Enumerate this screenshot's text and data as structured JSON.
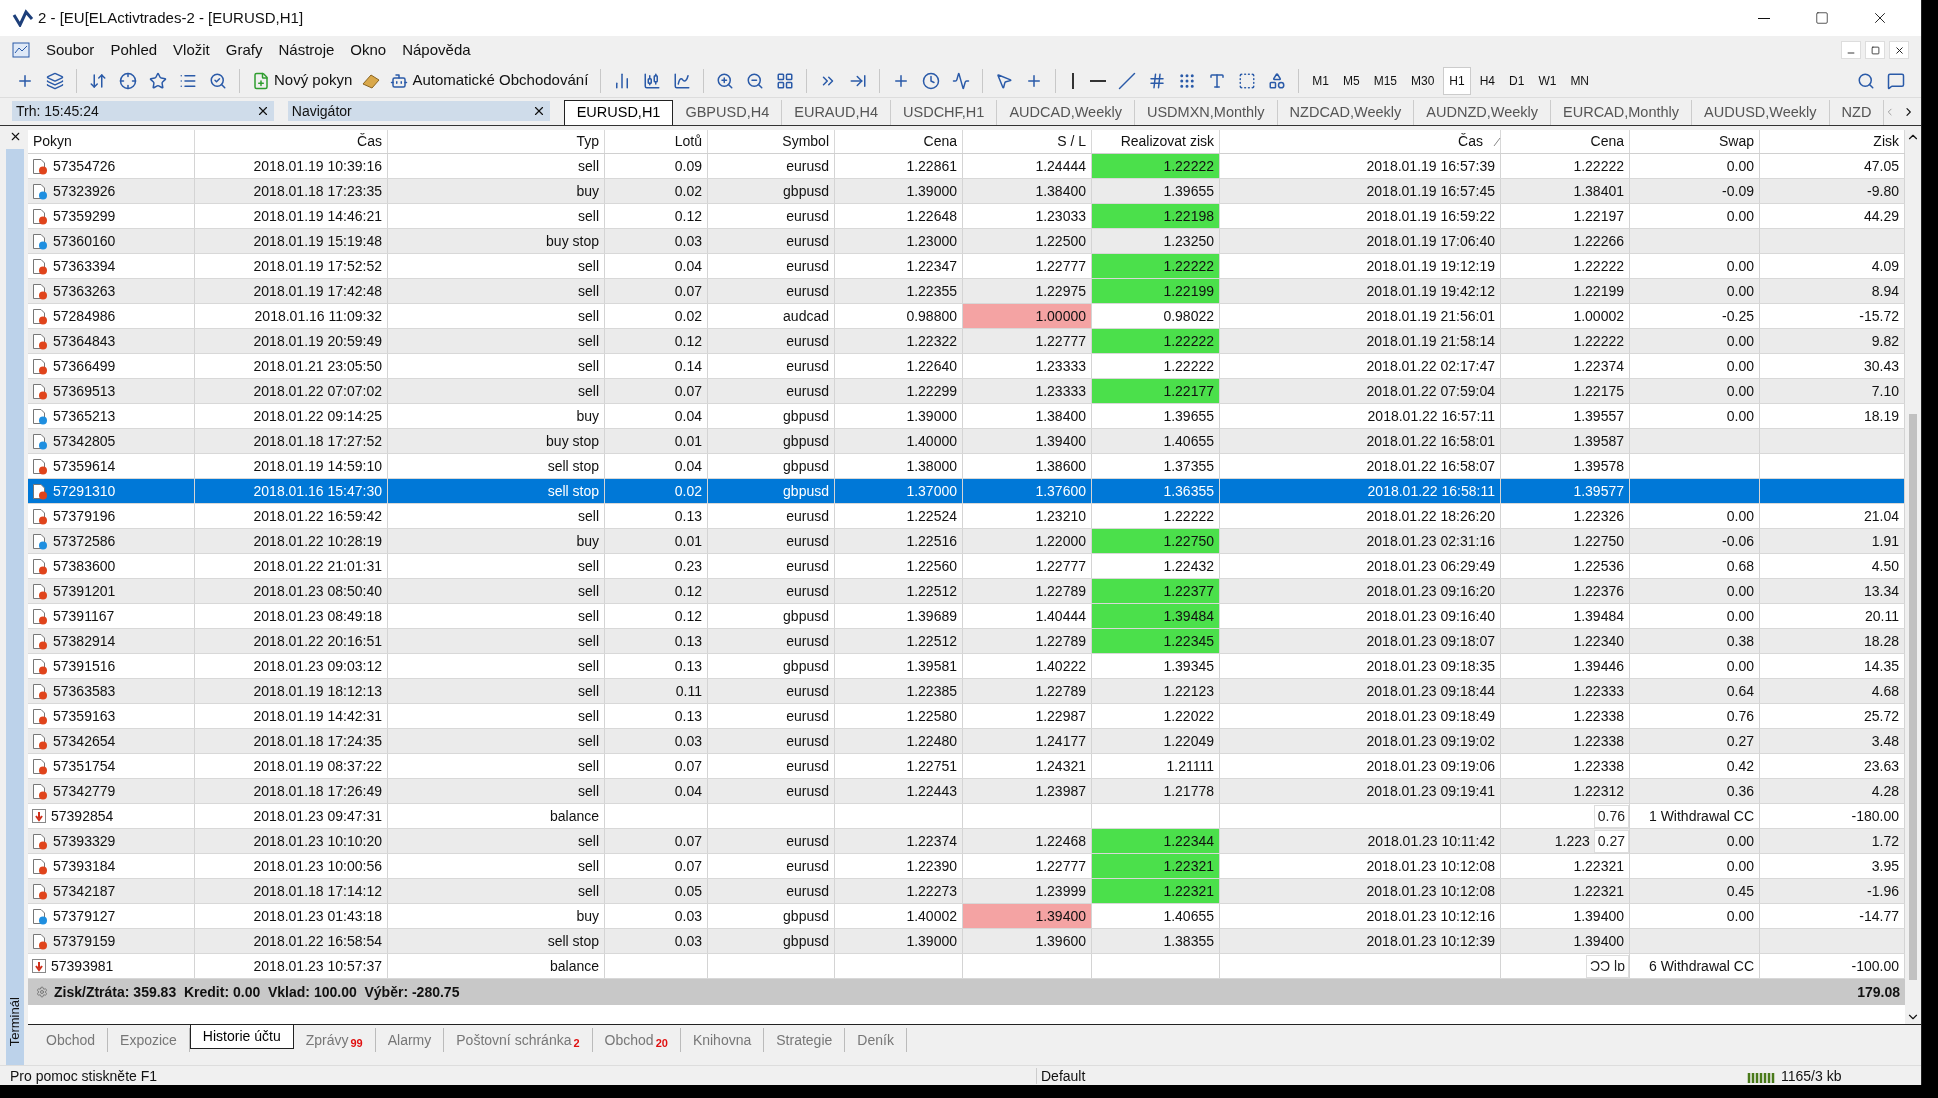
{
  "window": {
    "title": "2 - [EU[ELActivtrades-2 - [EURUSD,H1]"
  },
  "menu": [
    "Soubor",
    "Pohled",
    "Vložit",
    "Grafy",
    "Nástroje",
    "Okno",
    "Nápověda"
  ],
  "toolbar": {
    "new_order": "Nový pokyn",
    "auto_trading": "Automatické Obchodování"
  },
  "timeframes": [
    {
      "label": "M1",
      "selected": false
    },
    {
      "label": "M5",
      "selected": false
    },
    {
      "label": "M15",
      "selected": false
    },
    {
      "label": "M30",
      "selected": false
    },
    {
      "label": "H1",
      "selected": true
    },
    {
      "label": "H4",
      "selected": false
    },
    {
      "label": "D1",
      "selected": false
    },
    {
      "label": "W1",
      "selected": false
    },
    {
      "label": "MN",
      "selected": false
    }
  ],
  "panels": [
    {
      "title": "Trh: 15:45:24"
    },
    {
      "title": "Navigátor"
    }
  ],
  "chart_tabs": [
    {
      "label": "EURUSD,H1",
      "selected": true
    },
    {
      "label": "GBPUSD,H4",
      "selected": false
    },
    {
      "label": "EURAUD,H4",
      "selected": false
    },
    {
      "label": "USDCHF,H1",
      "selected": false
    },
    {
      "label": "AUDCAD,Weekly",
      "selected": false
    },
    {
      "label": "USDMXN,Monthly",
      "selected": false
    },
    {
      "label": "NZDCAD,Weekly",
      "selected": false
    },
    {
      "label": "AUDNZD,Weekly",
      "selected": false
    },
    {
      "label": "EURCAD,Monthly",
      "selected": false
    },
    {
      "label": "AUDUSD,Weekly",
      "selected": false
    },
    {
      "label": "NZD",
      "selected": false
    }
  ],
  "terminal_label": "Terminál",
  "table": {
    "columns": [
      "Pokyn",
      "Čas",
      "Typ",
      "Lotů",
      "Symbol",
      "Cena",
      "S / L",
      "Realizovat zisk",
      "Čas",
      "Cena",
      "Swap",
      "Zisk"
    ],
    "rows": [
      {
        "kind": "sell",
        "order": "57354726",
        "time": "2018.01.19 10:39:16",
        "type": "sell",
        "lots": "0.09",
        "symbol": "eurusd",
        "price": "1.22861",
        "sl": "1.24444",
        "tp": "1.22222",
        "sl_hit": false,
        "tp_hit": true,
        "close_time": "2018.01.19 16:57:39",
        "close_price": "1.22222",
        "swap": "0.00",
        "profit": "47.05",
        "selected": false
      },
      {
        "kind": "buy",
        "order": "57323926",
        "time": "2018.01.18 17:23:35",
        "type": "buy",
        "lots": "0.02",
        "symbol": "gbpusd",
        "price": "1.39000",
        "sl": "1.38400",
        "tp": "1.39655",
        "sl_hit": false,
        "tp_hit": false,
        "close_time": "2018.01.19 16:57:45",
        "close_price": "1.38401",
        "swap": "-0.09",
        "profit": "-9.80",
        "selected": false
      },
      {
        "kind": "sell",
        "order": "57359299",
        "time": "2018.01.19 14:46:21",
        "type": "sell",
        "lots": "0.12",
        "symbol": "eurusd",
        "price": "1.22648",
        "sl": "1.23033",
        "tp": "1.22198",
        "sl_hit": false,
        "tp_hit": true,
        "close_time": "2018.01.19 16:59:22",
        "close_price": "1.22197",
        "swap": "0.00",
        "profit": "44.29",
        "selected": false
      },
      {
        "kind": "buy",
        "order": "57360160",
        "time": "2018.01.19 15:19:48",
        "type": "buy stop",
        "lots": "0.03",
        "symbol": "eurusd",
        "price": "1.23000",
        "sl": "1.22500",
        "tp": "1.23250",
        "sl_hit": false,
        "tp_hit": false,
        "close_time": "2018.01.19 17:06:40",
        "close_price": "1.22266",
        "selected": false
      },
      {
        "kind": "sell",
        "order": "57363394",
        "time": "2018.01.19 17:52:52",
        "type": "sell",
        "lots": "0.04",
        "symbol": "eurusd",
        "price": "1.22347",
        "sl": "1.22777",
        "tp": "1.22222",
        "sl_hit": false,
        "tp_hit": true,
        "close_time": "2018.01.19 19:12:19",
        "close_price": "1.22222",
        "swap": "0.00",
        "profit": "4.09",
        "selected": false
      },
      {
        "kind": "sell",
        "order": "57363263",
        "time": "2018.01.19 17:42:48",
        "type": "sell",
        "lots": "0.07",
        "symbol": "eurusd",
        "price": "1.22355",
        "sl": "1.22975",
        "tp": "1.22199",
        "sl_hit": false,
        "tp_hit": true,
        "close_time": "2018.01.19 19:42:12",
        "close_price": "1.22199",
        "swap": "0.00",
        "profit": "8.94",
        "selected": false
      },
      {
        "kind": "sell",
        "order": "57284986",
        "time": "2018.01.16 11:09:32",
        "type": "sell",
        "lots": "0.02",
        "symbol": "audcad",
        "price": "0.98800",
        "sl": "1.00000",
        "tp": "0.98022",
        "sl_hit": true,
        "tp_hit": false,
        "close_time": "2018.01.19 21:56:01",
        "close_price": "1.00002",
        "swap": "-0.25",
        "profit": "-15.72",
        "selected": false
      },
      {
        "kind": "sell",
        "order": "57364843",
        "time": "2018.01.19 20:59:49",
        "type": "sell",
        "lots": "0.12",
        "symbol": "eurusd",
        "price": "1.22322",
        "sl": "1.22777",
        "tp": "1.22222",
        "sl_hit": false,
        "tp_hit": true,
        "close_time": "2018.01.19 21:58:14",
        "close_price": "1.22222",
        "swap": "0.00",
        "profit": "9.82",
        "selected": false
      },
      {
        "kind": "sell",
        "order": "57366499",
        "time": "2018.01.21 23:05:50",
        "type": "sell",
        "lots": "0.14",
        "symbol": "eurusd",
        "price": "1.22640",
        "sl": "1.23333",
        "tp": "1.22222",
        "sl_hit": false,
        "tp_hit": false,
        "close_time": "2018.01.22 02:17:47",
        "close_price": "1.22374",
        "swap": "0.00",
        "profit": "30.43",
        "selected": false
      },
      {
        "kind": "sell",
        "order": "57369513",
        "time": "2018.01.22 07:07:02",
        "type": "sell",
        "lots": "0.07",
        "symbol": "eurusd",
        "price": "1.22299",
        "sl": "1.23333",
        "tp": "1.22177",
        "sl_hit": false,
        "tp_hit": true,
        "close_time": "2018.01.22 07:59:04",
        "close_price": "1.22175",
        "swap": "0.00",
        "profit": "7.10",
        "selected": false
      },
      {
        "kind": "buy",
        "order": "57365213",
        "time": "2018.01.22 09:14:25",
        "type": "buy",
        "lots": "0.04",
        "symbol": "gbpusd",
        "price": "1.39000",
        "sl": "1.38400",
        "tp": "1.39655",
        "sl_hit": false,
        "tp_hit": false,
        "close_time": "2018.01.22 16:57:11",
        "close_price": "1.39557",
        "swap": "0.00",
        "profit": "18.19",
        "selected": false
      },
      {
        "kind": "buy",
        "order": "57342805",
        "time": "2018.01.18 17:27:52",
        "type": "buy stop",
        "lots": "0.01",
        "symbol": "gbpusd",
        "price": "1.40000",
        "sl": "1.39400",
        "tp": "1.40655",
        "sl_hit": false,
        "tp_hit": false,
        "close_time": "2018.01.22 16:58:01",
        "close_price": "1.39587",
        "selected": false
      },
      {
        "kind": "sell",
        "order": "57359614",
        "time": "2018.01.19 14:59:10",
        "type": "sell stop",
        "lots": "0.04",
        "symbol": "gbpusd",
        "price": "1.38000",
        "sl": "1.38600",
        "tp": "1.37355",
        "sl_hit": false,
        "tp_hit": false,
        "close_time": "2018.01.22 16:58:07",
        "close_price": "1.39578",
        "selected": false
      },
      {
        "kind": "sell",
        "order": "57291310",
        "time": "2018.01.16 15:47:30",
        "type": "sell stop",
        "lots": "0.02",
        "symbol": "gbpusd",
        "price": "1.37000",
        "sl": "1.37600",
        "tp": "1.36355",
        "close_time": "2018.01.22 16:58:11",
        "close_price": "1.39577",
        "selected": true
      },
      {
        "kind": "sell",
        "order": "57379196",
        "time": "2018.01.22 16:59:42",
        "type": "sell",
        "lots": "0.13",
        "symbol": "eurusd",
        "price": "1.22524",
        "sl": "1.23210",
        "tp": "1.22222",
        "sl_hit": false,
        "tp_hit": false,
        "close_time": "2018.01.22 18:26:20",
        "close_price": "1.22326",
        "swap": "0.00",
        "profit": "21.04",
        "selected": false
      },
      {
        "kind": "buy",
        "order": "57372586",
        "time": "2018.01.22 10:28:19",
        "type": "buy",
        "lots": "0.01",
        "symbol": "eurusd",
        "price": "1.22516",
        "sl": "1.22000",
        "tp": "1.22750",
        "sl_hit": false,
        "tp_hit": true,
        "close_time": "2018.01.23 02:31:16",
        "close_price": "1.22750",
        "swap": "-0.06",
        "profit": "1.91",
        "selected": false
      },
      {
        "kind": "sell",
        "order": "57383600",
        "time": "2018.01.22 21:01:31",
        "type": "sell",
        "lots": "0.23",
        "symbol": "eurusd",
        "price": "1.22560",
        "sl": "1.22777",
        "tp": "1.22432",
        "sl_hit": false,
        "tp_hit": false,
        "close_time": "2018.01.23 06:29:49",
        "close_price": "1.22536",
        "swap": "0.68",
        "profit": "4.50",
        "selected": false
      },
      {
        "kind": "sell",
        "order": "57391201",
        "time": "2018.01.23 08:50:40",
        "type": "sell",
        "lots": "0.12",
        "symbol": "eurusd",
        "price": "1.22512",
        "sl": "1.22789",
        "tp": "1.22377",
        "sl_hit": false,
        "tp_hit": true,
        "close_time": "2018.01.23 09:16:20",
        "close_price": "1.22376",
        "swap": "0.00",
        "profit": "13.34",
        "selected": false
      },
      {
        "kind": "sell",
        "order": "57391167",
        "time": "2018.01.23 08:49:18",
        "type": "sell",
        "lots": "0.12",
        "symbol": "gbpusd",
        "price": "1.39689",
        "sl": "1.40444",
        "tp": "1.39484",
        "sl_hit": false,
        "tp_hit": true,
        "close_time": "2018.01.23 09:16:40",
        "close_price": "1.39484",
        "swap": "0.00",
        "profit": "20.11",
        "selected": false
      },
      {
        "kind": "sell",
        "order": "57382914",
        "time": "2018.01.22 20:16:51",
        "type": "sell",
        "lots": "0.13",
        "symbol": "eurusd",
        "price": "1.22512",
        "sl": "1.22789",
        "tp": "1.22345",
        "sl_hit": false,
        "tp_hit": true,
        "close_time": "2018.01.23 09:18:07",
        "close_price": "1.22340",
        "swap": "0.38",
        "profit": "18.28",
        "selected": false
      },
      {
        "kind": "sell",
        "order": "57391516",
        "time": "2018.01.23 09:03:12",
        "type": "sell",
        "lots": "0.13",
        "symbol": "gbpusd",
        "price": "1.39581",
        "sl": "1.40222",
        "tp": "1.39345",
        "sl_hit": false,
        "tp_hit": false,
        "close_time": "2018.01.23 09:18:35",
        "close_price": "1.39446",
        "swap": "0.00",
        "profit": "14.35",
        "selected": false
      },
      {
        "kind": "sell",
        "order": "57363583",
        "time": "2018.01.19 18:12:13",
        "type": "sell",
        "lots": "0.11",
        "symbol": "eurusd",
        "price": "1.22385",
        "sl": "1.22789",
        "tp": "1.22123",
        "sl_hit": false,
        "tp_hit": false,
        "close_time": "2018.01.23 09:18:44",
        "close_price": "1.22333",
        "swap": "0.64",
        "profit": "4.68",
        "selected": false
      },
      {
        "kind": "sell",
        "order": "57359163",
        "time": "2018.01.19 14:42:31",
        "type": "sell",
        "lots": "0.13",
        "symbol": "eurusd",
        "price": "1.22580",
        "sl": "1.22987",
        "tp": "1.22022",
        "sl_hit": false,
        "tp_hit": false,
        "close_time": "2018.01.23 09:18:49",
        "close_price": "1.22338",
        "swap": "0.76",
        "profit": "25.72",
        "selected": false
      },
      {
        "kind": "sell",
        "order": "57342654",
        "time": "2018.01.18 17:24:35",
        "type": "sell",
        "lots": "0.03",
        "symbol": "eurusd",
        "price": "1.22480",
        "sl": "1.24177",
        "tp": "1.22049",
        "sl_hit": false,
        "tp_hit": false,
        "close_time": "2018.01.23 09:19:02",
        "close_price": "1.22338",
        "swap": "0.27",
        "profit": "3.48",
        "selected": false
      },
      {
        "kind": "sell",
        "order": "57351754",
        "time": "2018.01.19 08:37:22",
        "type": "sell",
        "lots": "0.07",
        "symbol": "eurusd",
        "price": "1.22751",
        "sl": "1.24321",
        "tp": "1.21111",
        "sl_hit": false,
        "tp_hit": false,
        "close_time": "2018.01.23 09:19:06",
        "close_price": "1.22338",
        "swap": "0.42",
        "profit": "23.63",
        "selected": false
      },
      {
        "kind": "sell",
        "order": "57342779",
        "time": "2018.01.18 17:26:49",
        "type": "sell",
        "lots": "0.04",
        "symbol": "eurusd",
        "price": "1.22443",
        "sl": "1.23987",
        "tp": "1.21778",
        "sl_hit": false,
        "tp_hit": false,
        "close_time": "2018.01.23 09:19:41",
        "close_price": "1.22312",
        "swap": "0.36",
        "profit": "4.28",
        "selected": false
      },
      {
        "kind": "balance",
        "order": "57392854",
        "time": "2018.01.23 09:47:31",
        "type": "balance",
        "ghost": "0.76",
        "comment": "1 Withdrawal CC",
        "profit": "-180.00",
        "selected": false
      },
      {
        "kind": "sell",
        "order": "57393329",
        "time": "2018.01.23 10:10:20",
        "type": "sell",
        "lots": "0.07",
        "symbol": "eurusd",
        "price": "1.22374",
        "sl": "1.22468",
        "tp": "1.22344",
        "sl_hit": false,
        "tp_hit": true,
        "close_time": "2018.01.23 10:11:42",
        "close_price": "1.223",
        "ghost": "0.27",
        "swap": "0.00",
        "profit": "1.72",
        "selected": false
      },
      {
        "kind": "sell",
        "order": "57393184",
        "time": "2018.01.23 10:00:56",
        "type": "sell",
        "lots": "0.07",
        "symbol": "eurusd",
        "price": "1.22390",
        "sl": "1.22777",
        "tp": "1.22321",
        "sl_hit": false,
        "tp_hit": true,
        "close_time": "2018.01.23 10:12:08",
        "close_price": "1.22321",
        "swap": "0.00",
        "profit": "3.95",
        "selected": false
      },
      {
        "kind": "sell",
        "order": "57342187",
        "time": "2018.01.18 17:14:12",
        "type": "sell",
        "lots": "0.05",
        "symbol": "eurusd",
        "price": "1.22273",
        "sl": "1.23999",
        "tp": "1.22321",
        "sl_hit": false,
        "tp_hit": true,
        "close_time": "2018.01.23 10:12:08",
        "close_price": "1.22321",
        "swap": "0.45",
        "profit": "-1.96",
        "selected": false
      },
      {
        "kind": "buy",
        "order": "57379127",
        "time": "2018.01.23 01:43:18",
        "type": "buy",
        "lots": "0.03",
        "symbol": "gbpusd",
        "price": "1.40002",
        "sl": "1.39400",
        "tp": "1.40655",
        "sl_hit": true,
        "tp_hit": false,
        "close_time": "2018.01.23 10:12:16",
        "close_price": "1.39400",
        "swap": "0.00",
        "profit": "-14.77",
        "selected": false
      },
      {
        "kind": "sell",
        "order": "57379159",
        "time": "2018.01.22 16:58:54",
        "type": "sell stop",
        "lots": "0.03",
        "symbol": "gbpusd",
        "price": "1.39000",
        "sl": "1.39600",
        "tp": "1.38355",
        "sl_hit": false,
        "tp_hit": false,
        "close_time": "2018.01.23 10:12:39",
        "close_price": "1.39400",
        "selected": false
      },
      {
        "kind": "balance",
        "order": "57393981",
        "time": "2018.01.23 10:57:37",
        "type": "balance",
        "ghost": "ƆƆ lɒ",
        "comment": "6 Withdrawal CC",
        "profit": "-100.00",
        "selected": false
      }
    ],
    "summary": {
      "text": "Zisk/Ztráta: 359.83  Kredit: 0.00  Vklad: 100.00  Výběr: -280.75",
      "total": "179.08"
    }
  },
  "bottom_tabs": [
    {
      "label": "Obchod",
      "selected": false
    },
    {
      "label": "Expozice",
      "selected": false
    },
    {
      "label": "Historie účtu",
      "selected": true
    },
    {
      "label": "Zprávy",
      "badge": "99",
      "selected": false
    },
    {
      "label": "Alarmy",
      "selected": false
    },
    {
      "label": "Poštovní schránka",
      "badge": "2",
      "selected": false
    },
    {
      "label": "Obchod",
      "badge": "20",
      "selected": false
    },
    {
      "label": "Knihovna",
      "selected": false
    },
    {
      "label": "Strategie",
      "selected": false
    },
    {
      "label": "Deník",
      "selected": false
    }
  ],
  "status_bar": {
    "help": "Pro pomoc stiskněte F1",
    "profile": "Default",
    "traffic": "1165/3 kb"
  }
}
